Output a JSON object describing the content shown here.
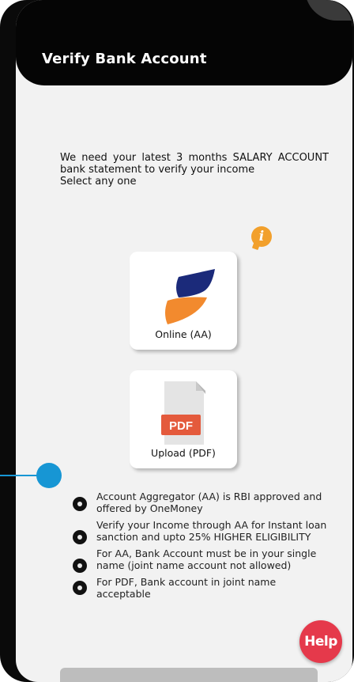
{
  "header": {
    "title": "Verify Bank Account"
  },
  "instructions": {
    "line1": "We need your latest 3 months SALARY ACCOUNT bank statement to verify your income",
    "line2": "Select any one"
  },
  "info": {
    "glyph": "i",
    "icon": "info-icon",
    "color": "#F2A02C"
  },
  "options": [
    {
      "label": "Online (AA)",
      "icon": "onemoney-logo"
    },
    {
      "label": "Upload (PDF)",
      "icon": "pdf-file-icon",
      "badge": "PDF"
    }
  ],
  "notes": [
    "Account Aggregator (AA) is RBI approved and offered by OneMoney",
    "Verify your Income through AA for Instant loan sanction and upto 25% HIGHER ELIGIBILITY",
    "For AA, Bank Account must be in your single name (joint name account not allowed)",
    "For PDF, Bank account in joint name acceptable"
  ],
  "help": {
    "label": "Help",
    "color": "#E5394B"
  },
  "colors": {
    "header": "#050505",
    "accent_blue": "#1796D4",
    "logo_navy": "#1B2A7A",
    "logo_orange": "#F28A2E",
    "pdf_red": "#E45A3C"
  }
}
